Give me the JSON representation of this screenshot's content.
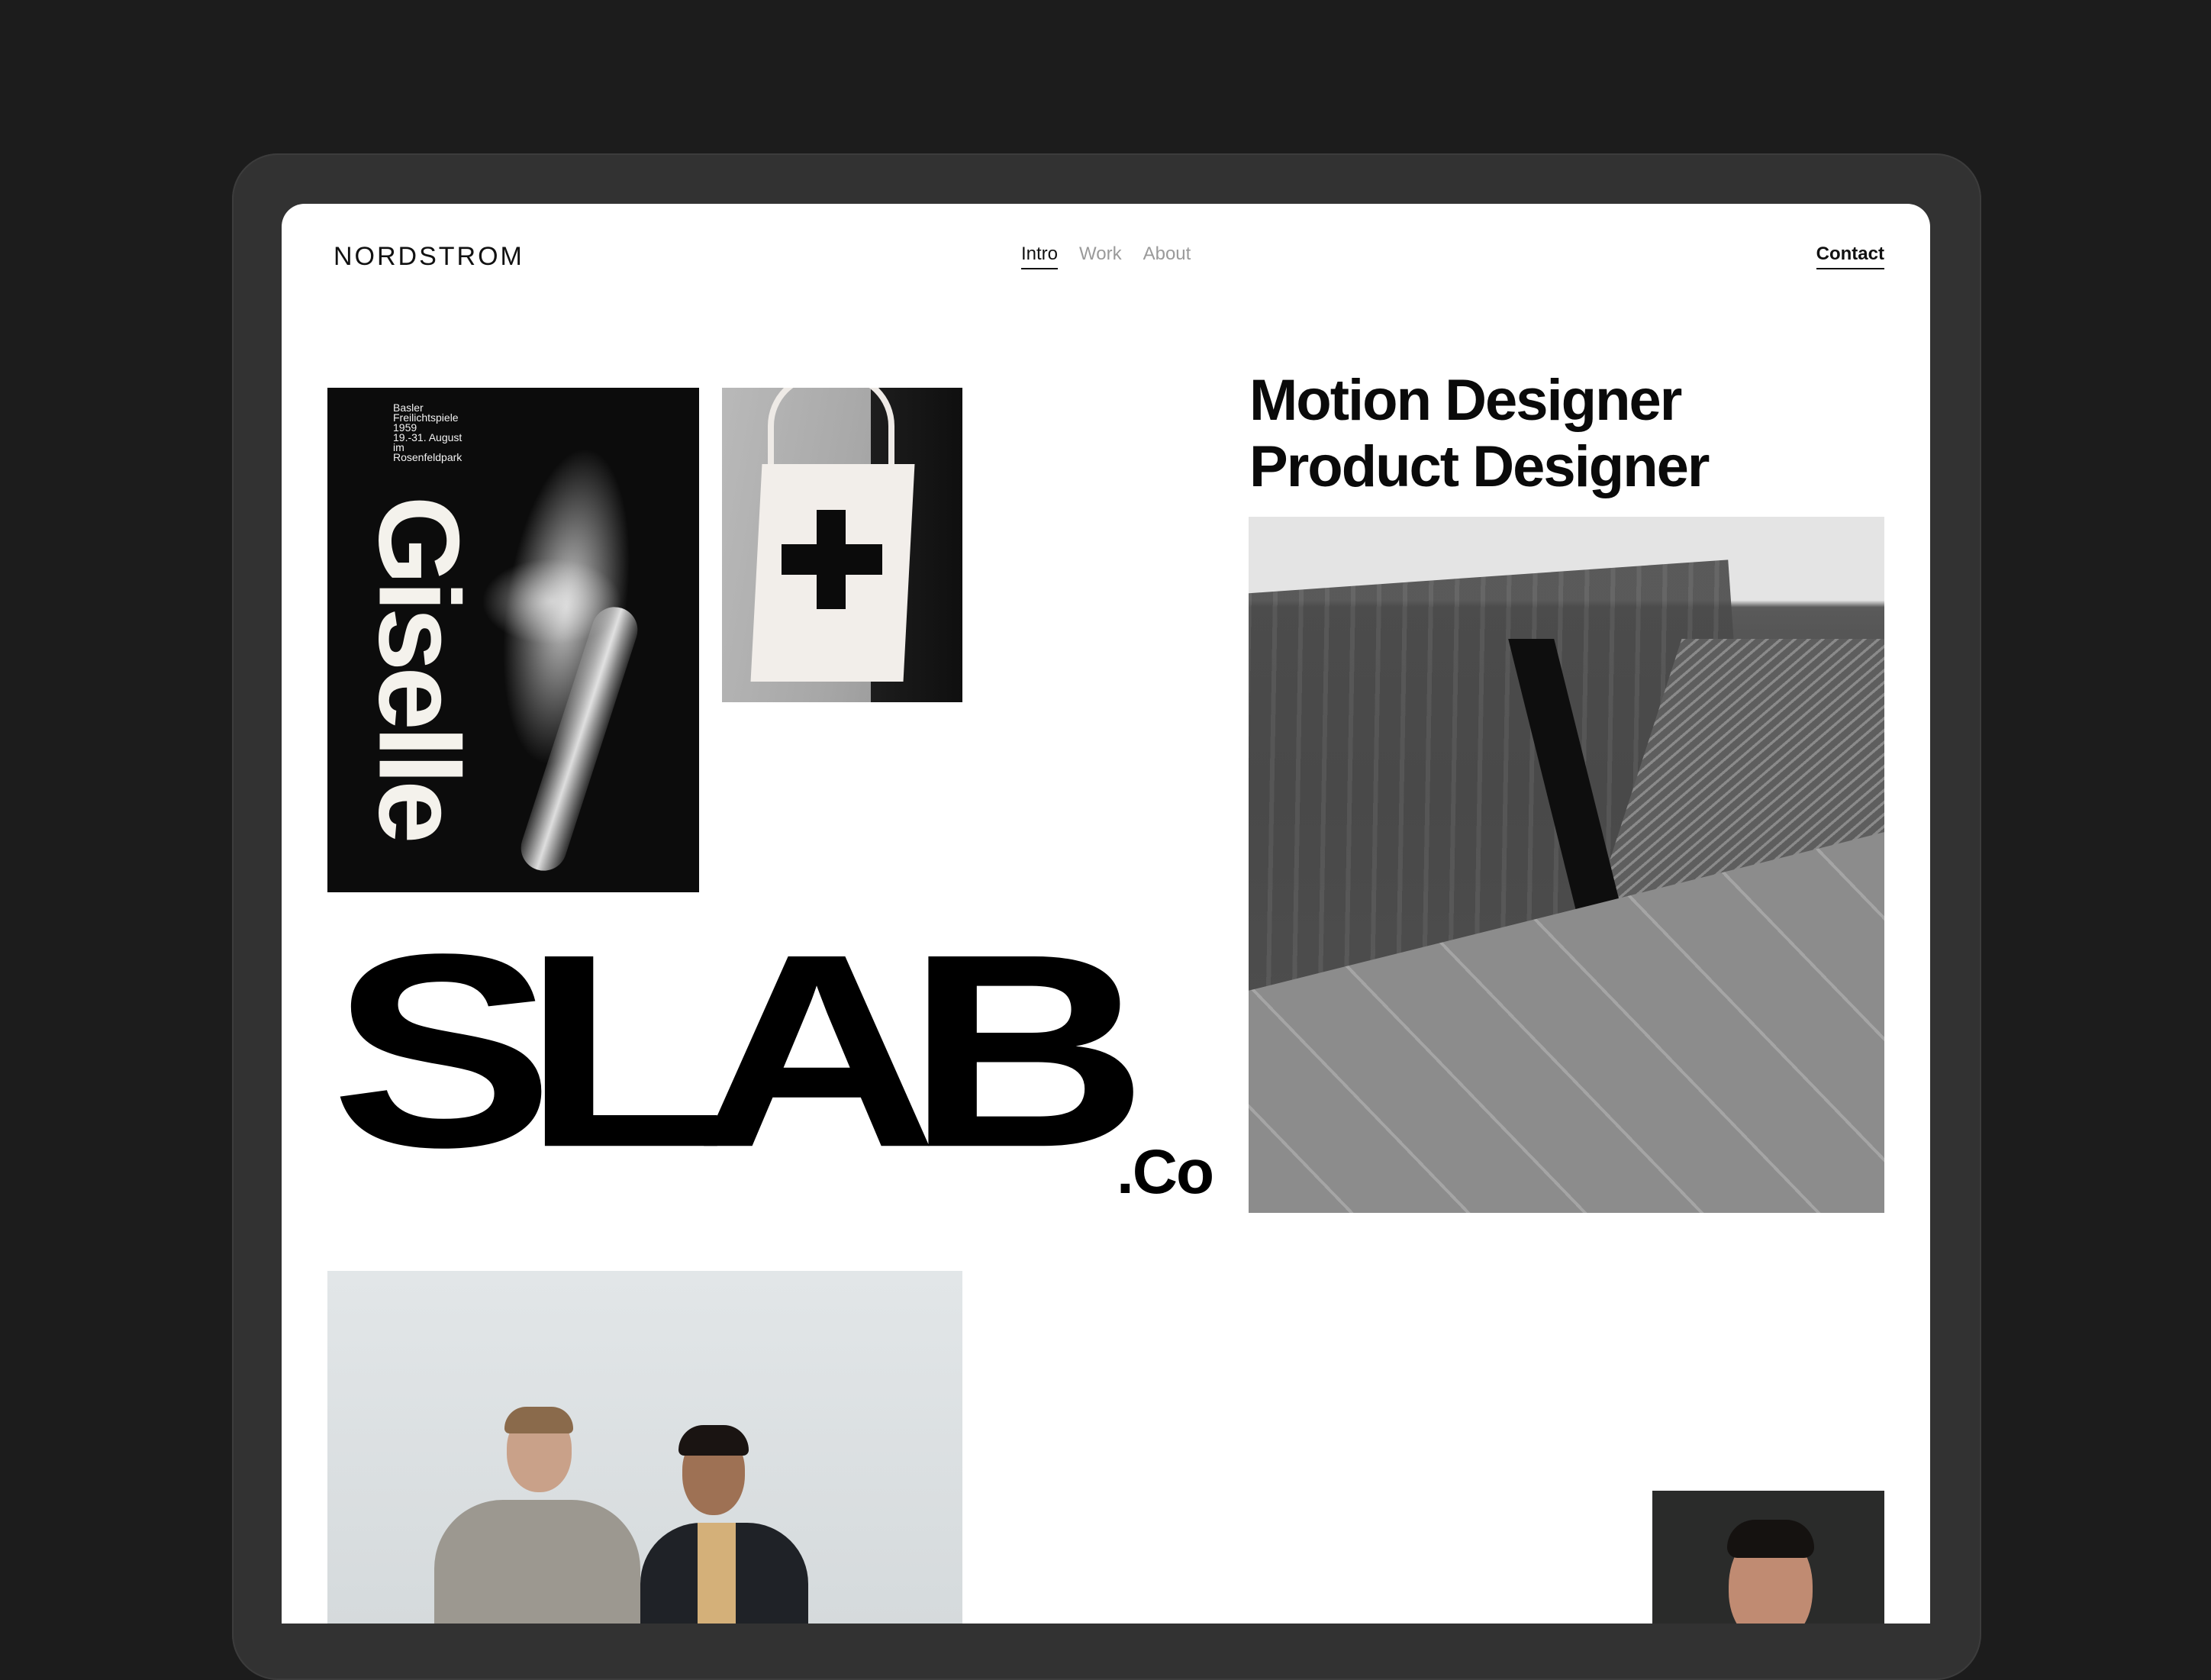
{
  "header": {
    "logo": "NORDSTROM",
    "nav": [
      "Intro",
      "Work",
      "About"
    ],
    "active_nav": "Intro",
    "contact": "Contact"
  },
  "poster": {
    "info": "Basler\nFreilichtspiele\n1959\n19.-31. August\nim\nRosenfeldpark",
    "title": "Giselle"
  },
  "hero": {
    "line1": "Motion Designer",
    "line2": "Product Designer"
  },
  "brand": {
    "wordmark": "SLAB",
    "suffix": ".Co"
  },
  "colors": {
    "page_bg": "#1c1c1c",
    "device": "#323232",
    "screen": "#ffffff",
    "ink": "#0a0a0a",
    "muted_nav": "#9a9a9a"
  }
}
